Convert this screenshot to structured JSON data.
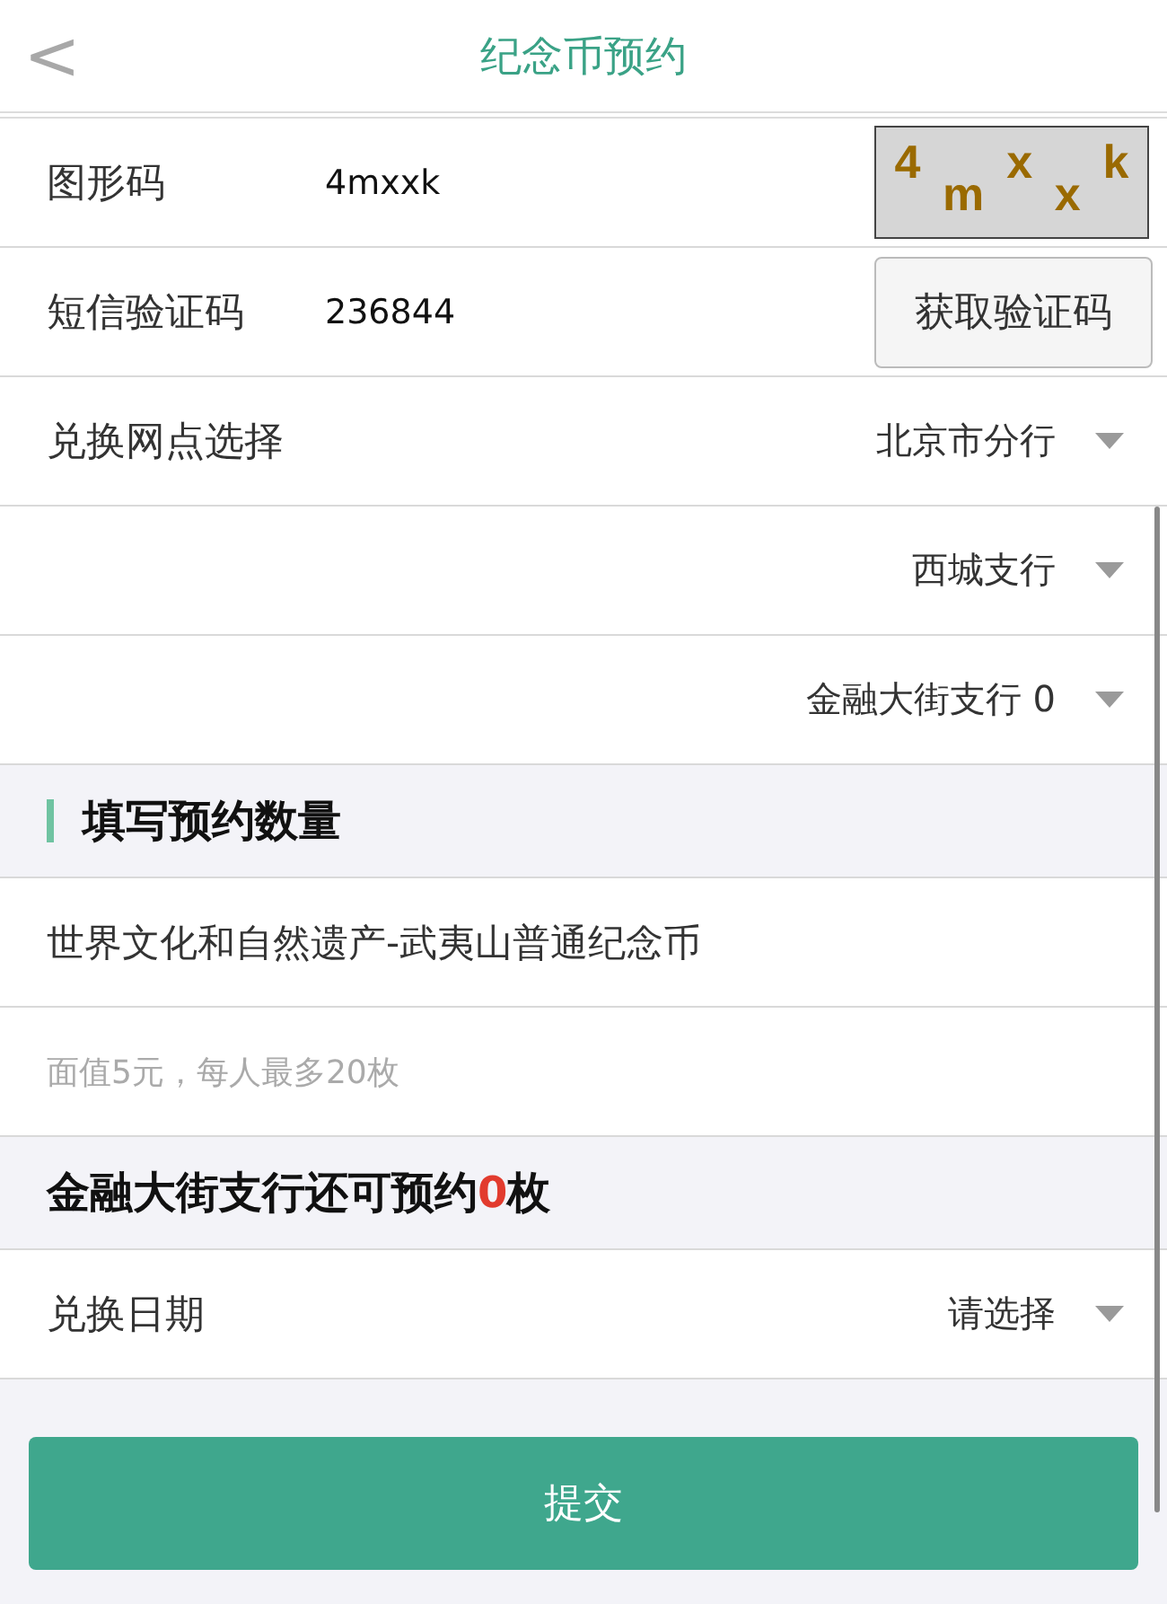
{
  "header": {
    "back": "<",
    "title": "纪念币预约"
  },
  "fields": [
    {
      "kind": "captcha",
      "label": "图形码",
      "value": "4mxxk",
      "captcha": [
        "4",
        "m",
        "x",
        "x",
        "k"
      ]
    },
    {
      "kind": "sms",
      "label": "短信验证码",
      "value": "236844",
      "button": "获取验证码"
    },
    {
      "kind": "select",
      "label": "兑换网点选择",
      "value": "北京市分行"
    },
    {
      "kind": "select",
      "value": "西城支行"
    },
    {
      "kind": "select",
      "value": "金融大街支行 0"
    }
  ],
  "section": {
    "title": "填写预约数量"
  },
  "coin": {
    "name": "世界文化和自然遗产-武夷山普通纪念币",
    "note": "面值5元，每人最多20枚"
  },
  "availability": {
    "before": "金融大街支行还可预约",
    "count": "0",
    "after": "枚"
  },
  "date": {
    "label": "兑换日期",
    "value": "请选择"
  },
  "submit": "提交"
}
